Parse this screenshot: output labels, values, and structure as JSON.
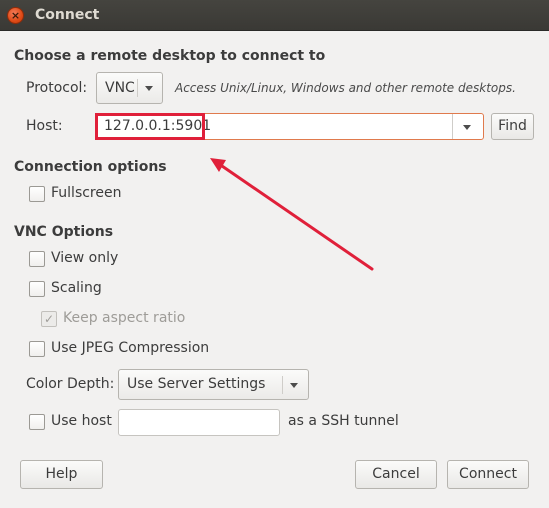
{
  "window": {
    "title": "Connect",
    "close_glyph": "×"
  },
  "header": {
    "title": "Choose a remote desktop to connect to"
  },
  "protocol": {
    "label": "Protocol:",
    "value": "VNC",
    "description": "Access Unix/Linux, Windows and other remote desktops."
  },
  "host": {
    "label": "Host:",
    "value": "127.0.0.1:5901",
    "find_label": "Find"
  },
  "connection_options": {
    "title": "Connection options",
    "fullscreen": {
      "label": "Fullscreen",
      "checked": false
    }
  },
  "vnc_options": {
    "title": "VNC Options",
    "view_only": {
      "label": "View only",
      "checked": false
    },
    "scaling": {
      "label": "Scaling",
      "checked": false
    },
    "keep_aspect": {
      "label": "Keep aspect ratio",
      "checked": true,
      "disabled": true
    },
    "jpeg": {
      "label": "Use JPEG Compression",
      "checked": false
    },
    "color_depth": {
      "label": "Color Depth:",
      "value": "Use Server Settings"
    },
    "ssh": {
      "label": "Use host",
      "value": "",
      "suffix": "as a SSH tunnel",
      "checked": false
    }
  },
  "footer": {
    "help_label": "Help",
    "cancel_label": "Cancel",
    "connect_label": "Connect"
  },
  "annotation": {
    "color": "#e0203a"
  },
  "colors": {
    "accent": "#e07a4d",
    "close_button": "#df4a16",
    "titlebar": "#3f3e3a",
    "check": "#a09e9a"
  },
  "icons": {
    "close": "close-icon",
    "dropdown": "chevron-down-icon",
    "check": "checkmark-icon",
    "arrow": "arrow-annotation-icon"
  }
}
